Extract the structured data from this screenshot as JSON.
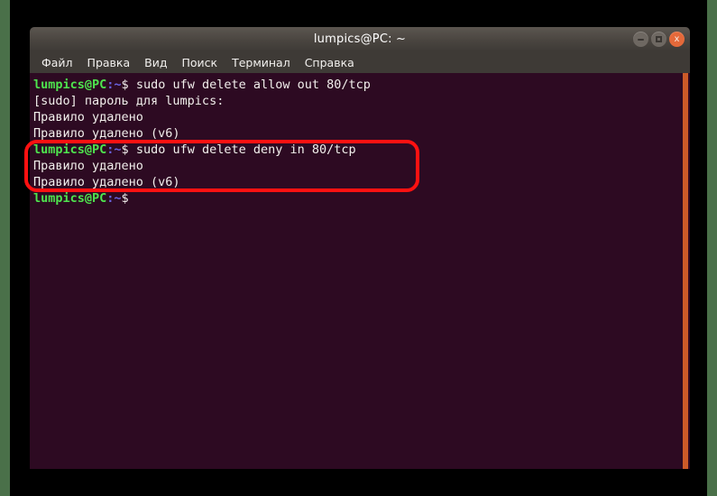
{
  "window": {
    "title": "lumpics@PC: ~",
    "controls": [
      {
        "name": "minimize",
        "glyph": "–"
      },
      {
        "name": "maximize",
        "glyph": "□"
      },
      {
        "name": "close",
        "glyph": "x"
      }
    ]
  },
  "menu": {
    "items": [
      {
        "label": "Файл"
      },
      {
        "label": "Правка"
      },
      {
        "label": "Вид"
      },
      {
        "label": "Поиск"
      },
      {
        "label": "Терминал"
      },
      {
        "label": "Справка"
      }
    ]
  },
  "terminal": {
    "prompt": {
      "user_host": "lumpics@PC",
      "separator": ":",
      "path": "~",
      "sigil": "$"
    },
    "lines": [
      {
        "type": "prompt",
        "command": " sudo ufw delete allow out 80/tcp"
      },
      {
        "type": "output",
        "text": "[sudo] пароль для lumpics:"
      },
      {
        "type": "output",
        "text": "Правило удалено"
      },
      {
        "type": "output",
        "text": "Правило удалено (v6)"
      },
      {
        "type": "prompt",
        "command": " sudo ufw delete deny in 80/tcp"
      },
      {
        "type": "output",
        "text": "Правило удалено"
      },
      {
        "type": "output",
        "text": "Правило удалено (v6)"
      },
      {
        "type": "prompt",
        "command": ""
      }
    ]
  },
  "annotation": {
    "highlight_color": "#ff1111",
    "covers_lines": [
      5,
      6,
      7
    ]
  },
  "colors": {
    "terminal_background": "#2d0a22",
    "prompt_green": "#4ee44e",
    "prompt_blue": "#6a62e0",
    "text_white": "#f2efec",
    "titlebar": "#4a4540",
    "menubar": "#3e3a36",
    "close_button": "#e4693a",
    "scrollbar": "#cc5a28",
    "page_edge_green": "#4a7049"
  }
}
